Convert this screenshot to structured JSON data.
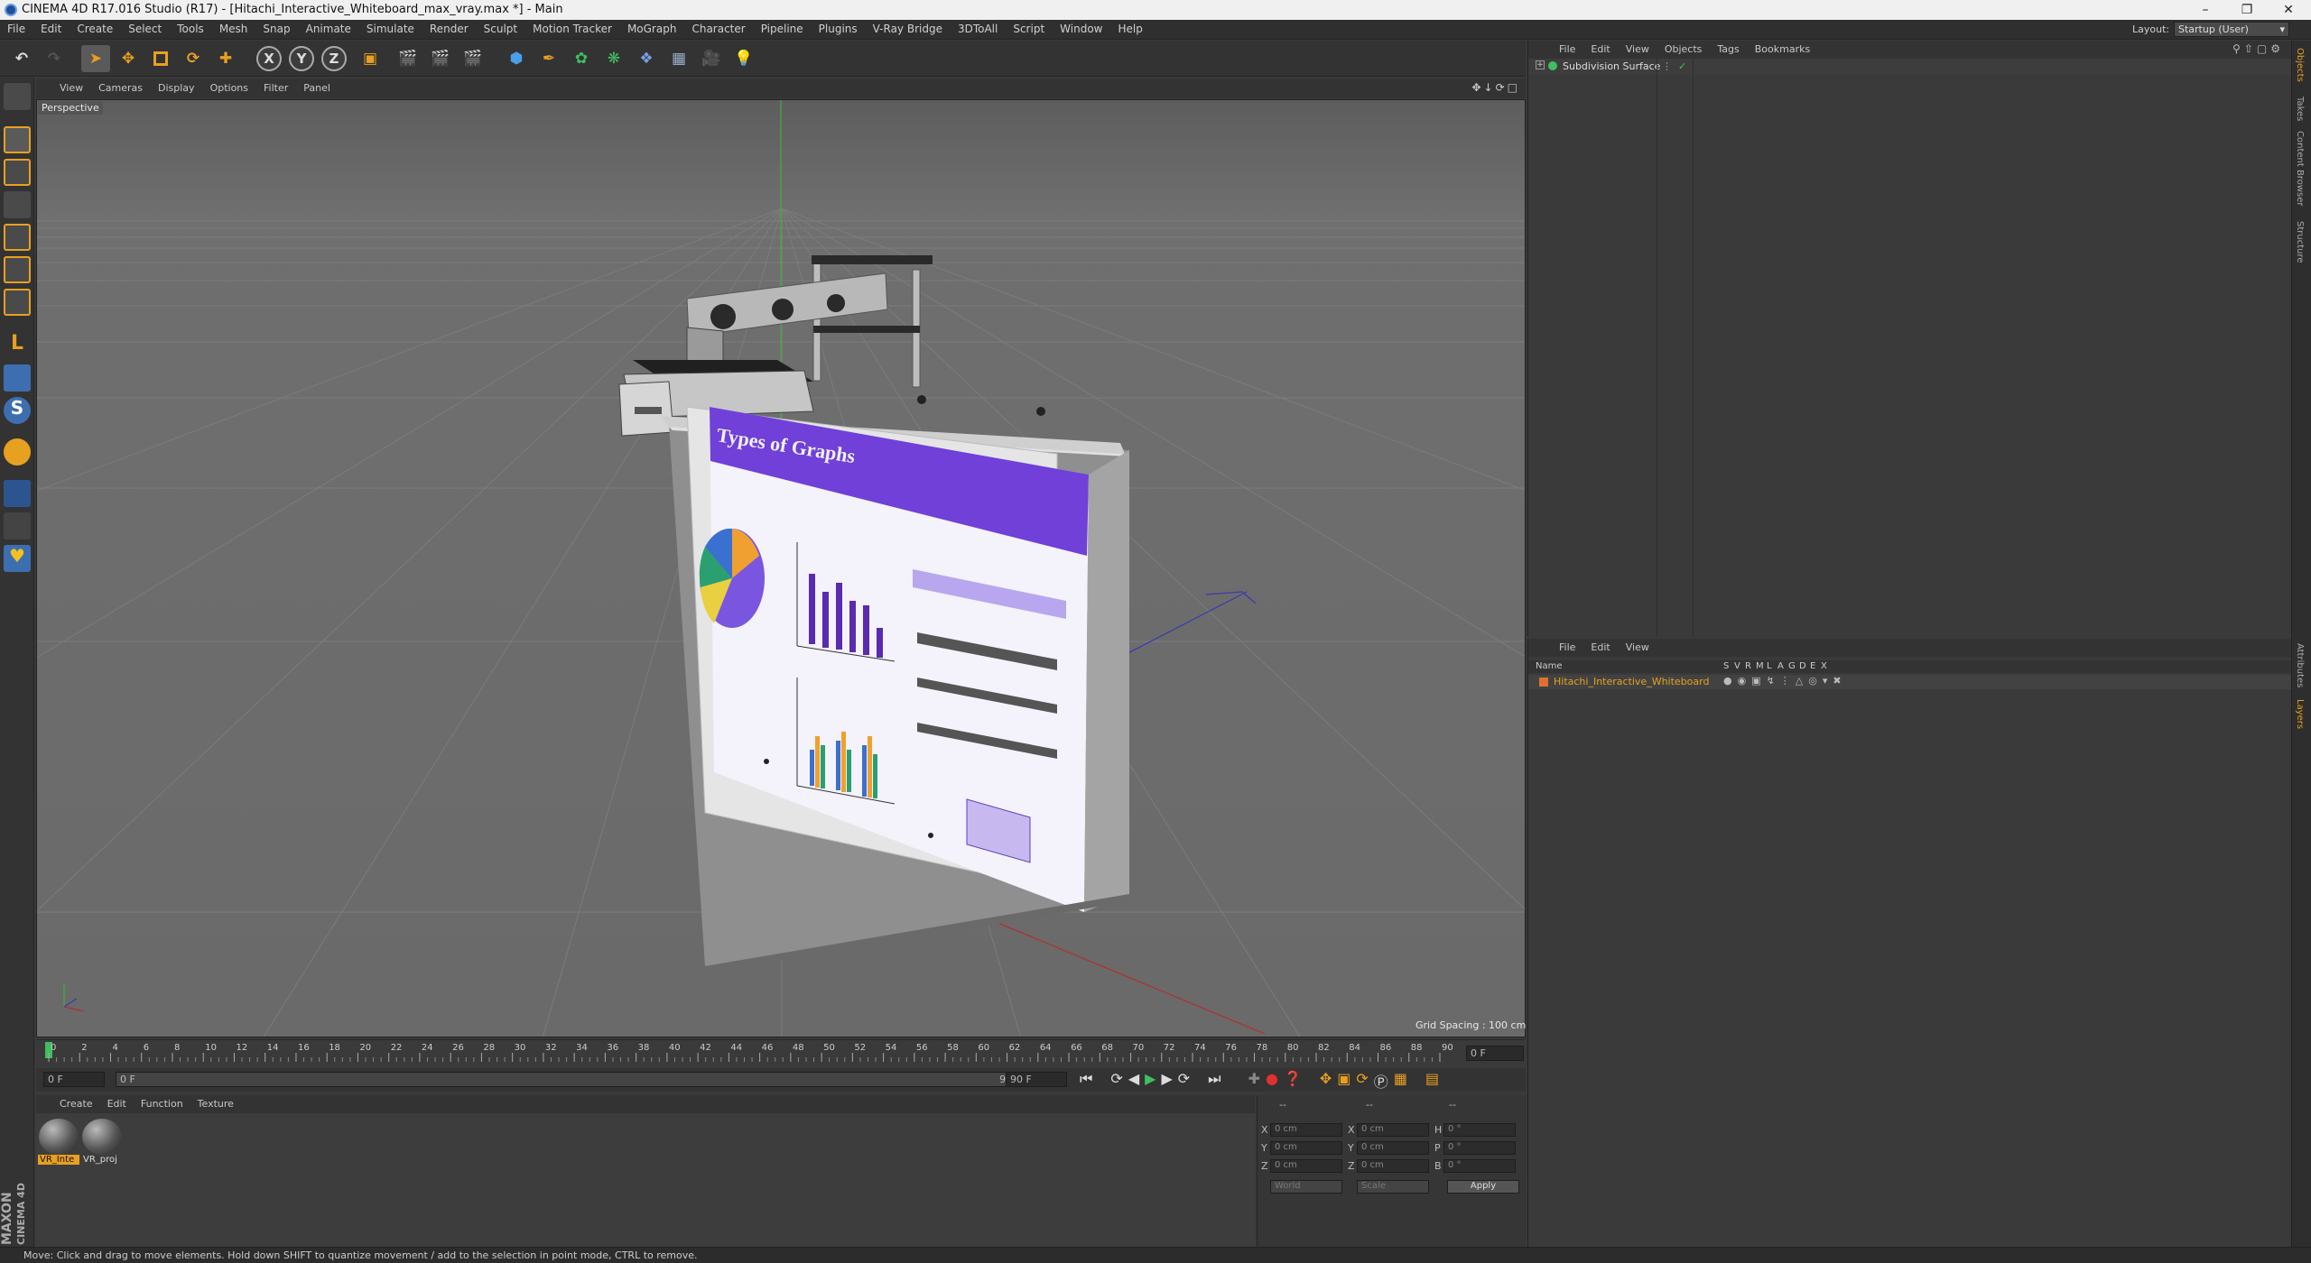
{
  "window": {
    "title": "CINEMA 4D R17.016 Studio (R17) - [Hitachi_Interactive_Whiteboard_max_vray.max *] - Main",
    "minimize": "–",
    "restore": "❐",
    "close": "✕"
  },
  "menubar": {
    "items": [
      "File",
      "Edit",
      "Create",
      "Select",
      "Tools",
      "Mesh",
      "Snap",
      "Animate",
      "Simulate",
      "Render",
      "Sculpt",
      "Motion Tracker",
      "MoGraph",
      "Character",
      "Pipeline",
      "Plugins",
      "V-Ray Bridge",
      "3DToAll",
      "Script",
      "Window",
      "Help"
    ],
    "layout_label": "Layout:",
    "layout_value": "Startup (User)"
  },
  "toolbar": {
    "axis_x": "X",
    "axis_y": "Y",
    "axis_z": "Z"
  },
  "viewport": {
    "menu": [
      "View",
      "Cameras",
      "Display",
      "Options",
      "Filter",
      "Panel"
    ],
    "label": "Perspective",
    "grid_spacing": "Grid Spacing : 100 cm"
  },
  "whiteboard_screen": {
    "heading": "Types of Graphs"
  },
  "timeline": {
    "ticks": [
      "0",
      "2",
      "4",
      "6",
      "8",
      "10",
      "12",
      "14",
      "16",
      "18",
      "20",
      "22",
      "24",
      "26",
      "28",
      "30",
      "32",
      "34",
      "36",
      "38",
      "40",
      "42",
      "44",
      "46",
      "48",
      "50",
      "52",
      "54",
      "56",
      "58",
      "60",
      "62",
      "64",
      "66",
      "68",
      "70",
      "72",
      "74",
      "76",
      "78",
      "80",
      "82",
      "84",
      "86",
      "88",
      "90"
    ],
    "current_frame": "0 F"
  },
  "timecontrol": {
    "start": "0 F",
    "slider_start": "0 F",
    "slider_end": "90 F",
    "end": "90 F"
  },
  "materials": {
    "menu": [
      "Create",
      "Edit",
      "Function",
      "Texture"
    ],
    "items": [
      {
        "label": "VR_Inte",
        "selected": true
      },
      {
        "label": "VR_proj",
        "selected": false
      }
    ],
    "brand_1": "MAXON",
    "brand_2": "CINEMA 4D"
  },
  "coordinates": {
    "header": [
      "--",
      "--",
      "--"
    ],
    "rows": [
      {
        "a": "X",
        "av": "0 cm",
        "b": "X",
        "bv": "0 cm",
        "c": "H",
        "cv": "0 °"
      },
      {
        "a": "Y",
        "av": "0 cm",
        "b": "Y",
        "bv": "0 cm",
        "c": "P",
        "cv": "0 °"
      },
      {
        "a": "Z",
        "av": "0 cm",
        "b": "Z",
        "bv": "0 cm",
        "c": "B",
        "cv": "0 °"
      }
    ],
    "mode": "World",
    "scale": "Scale",
    "apply": "Apply"
  },
  "objects_panel": {
    "menu": [
      "File",
      "Edit",
      "View",
      "Objects",
      "Tags",
      "Bookmarks"
    ],
    "item": "Subdivision Surface"
  },
  "layers_panel": {
    "menu": [
      "File",
      "Edit",
      "View"
    ],
    "col_name": "Name",
    "col_flags": [
      "S",
      "V",
      "R",
      "M",
      "L",
      "A",
      "G",
      "D",
      "E",
      "X"
    ],
    "item": "Hitachi_Interactive_Whiteboard"
  },
  "right_tabs": [
    "Objects",
    "Takes",
    "Content Browser",
    "Structure",
    "Attributes",
    "Layers"
  ],
  "status": "Move: Click and drag to move elements. Hold down SHIFT to quantize movement / add to the selection in point mode, CTRL to remove.",
  "colors": {
    "accent": "#e8a020",
    "object_green": "#3fbf5f",
    "layer_orange": "#e07030",
    "screen_purple": "#7040d8"
  }
}
